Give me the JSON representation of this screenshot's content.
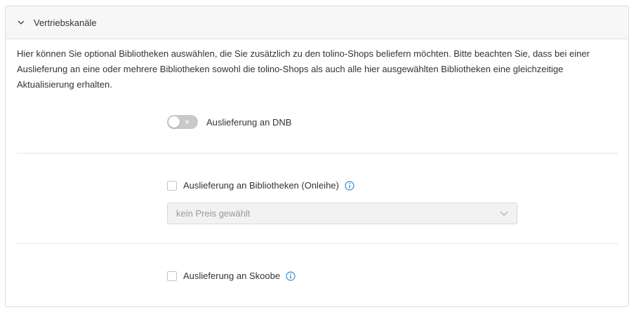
{
  "panel": {
    "title": "Vertriebskanäle",
    "intro": "Hier können Sie optional Bibliotheken auswählen, die Sie zusätzlich zu den tolino-Shops beliefern möchten. Bitte beachten Sie, dass bei einer Auslieferung an eine oder mehrere Bibliotheken sowohl die tolino-Shops als auch alle hier ausgewählten Bibliotheken eine gleichzeitige Aktualisierung erhalten."
  },
  "dnb": {
    "label": "Auslieferung an DNB",
    "toggle_symbol": "×",
    "enabled": false
  },
  "libraries": {
    "label": "Auslieferung an Bibliotheken (Onleihe)",
    "checked": false,
    "price_select": "kein Preis gewählt"
  },
  "skoobe": {
    "label": "Auslieferung an Skoobe",
    "checked": false
  },
  "colors": {
    "accent_info": "#2e8bd8",
    "toggle_off": "#c9c9c9"
  },
  "icons": [
    "chevron-down-icon",
    "info-icon",
    "chevron-down-icon"
  ]
}
